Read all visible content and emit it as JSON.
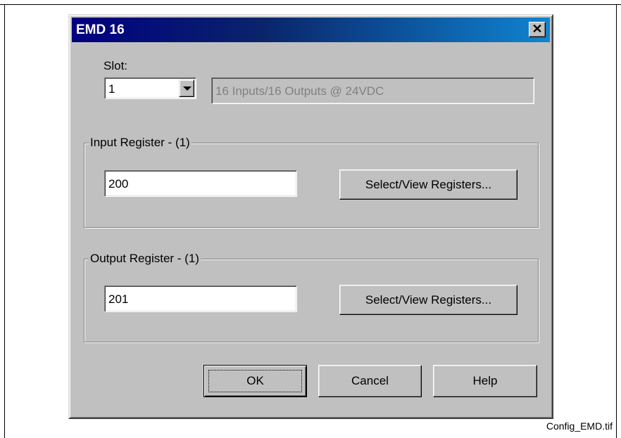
{
  "dialog": {
    "title": "EMD 16",
    "close_label": "✕"
  },
  "slot": {
    "label": "Slot:",
    "selected": "1",
    "description": "16 Inputs/16 Outputs @ 24VDC"
  },
  "input_register": {
    "legend": "Input Register - (1)",
    "value": "200",
    "button_label": "Select/View Registers..."
  },
  "output_register": {
    "legend": "Output Register - (1)",
    "value": "201",
    "button_label": "Select/View Registers..."
  },
  "buttons": {
    "ok": "OK",
    "cancel": "Cancel",
    "help": "Help"
  },
  "caption": "Config_EMD.tif",
  "colors": {
    "title_bar_start": "#000080",
    "title_bar_end": "#1084d0",
    "dialog_face": "#c0c0c0"
  }
}
